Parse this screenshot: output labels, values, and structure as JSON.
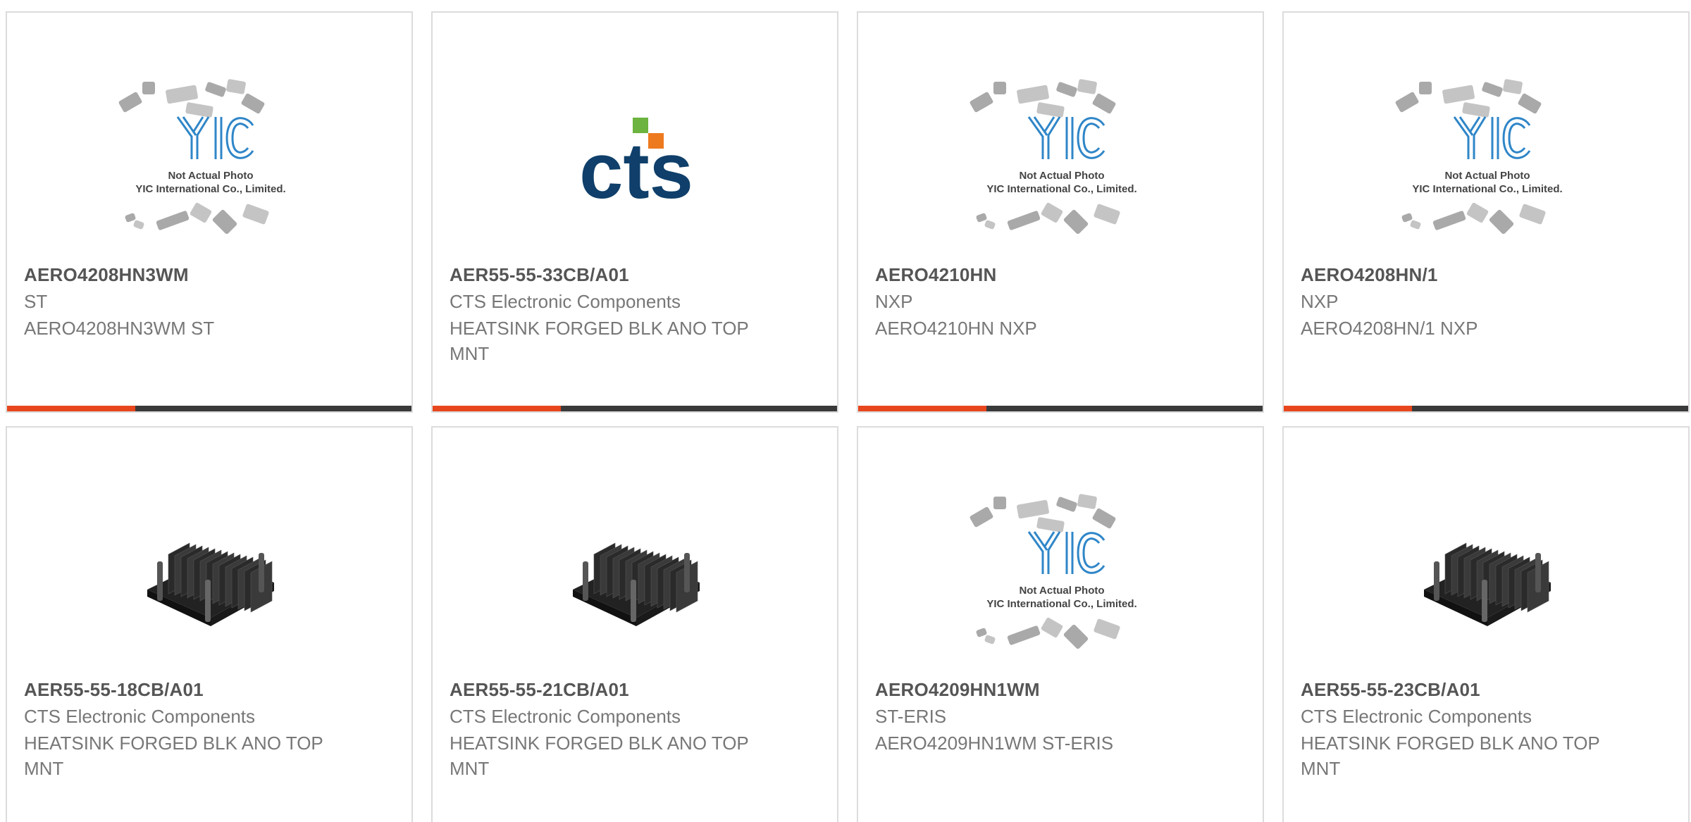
{
  "colors": {
    "accent": "#e8461d",
    "bar_dark": "#3a3a3a",
    "yic_blue": "#2f86c8",
    "cts_navy": "#0f3f6a",
    "cts_green": "#6cb33f",
    "cts_orange": "#ee7a1f"
  },
  "placeholder": {
    "line1": "Not Actual Photo",
    "line2": "YIC International Co., Limited."
  },
  "cts_logo_text": "cts",
  "products": [
    {
      "part": "AERO4208HN3WM",
      "manufacturer": "ST",
      "description": "AERO4208HN3WM ST",
      "image": "yic-placeholder",
      "accent_bar": true
    },
    {
      "part": "AER55-55-33CB/A01",
      "manufacturer": "CTS Electronic Components",
      "description": "HEATSINK FORGED BLK ANO TOP MNT",
      "image": "cts-logo",
      "accent_bar": true
    },
    {
      "part": "AERO4210HN",
      "manufacturer": "NXP",
      "description": "AERO4210HN NXP",
      "image": "yic-placeholder",
      "accent_bar": true
    },
    {
      "part": "AERO4208HN/1",
      "manufacturer": "NXP",
      "description": "AERO4208HN/1 NXP",
      "image": "yic-placeholder",
      "accent_bar": true
    },
    {
      "part": "AER55-55-18CB/A01",
      "manufacturer": "CTS Electronic Components",
      "description": "HEATSINK FORGED BLK ANO TOP MNT",
      "image": "heatsink",
      "accent_bar": false
    },
    {
      "part": "AER55-55-21CB/A01",
      "manufacturer": "CTS Electronic Components",
      "description": "HEATSINK FORGED BLK ANO TOP MNT",
      "image": "heatsink",
      "accent_bar": false
    },
    {
      "part": "AERO4209HN1WM",
      "manufacturer": "ST-ERIS",
      "description": "AERO4209HN1WM ST-ERIS",
      "image": "yic-placeholder",
      "accent_bar": false
    },
    {
      "part": "AER55-55-23CB/A01",
      "manufacturer": "CTS Electronic Components",
      "description": "HEATSINK FORGED BLK ANO TOP MNT",
      "image": "heatsink",
      "accent_bar": false
    }
  ]
}
